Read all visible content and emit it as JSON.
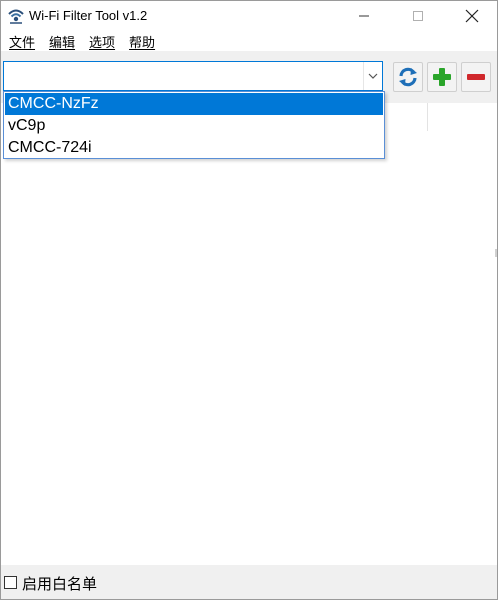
{
  "window": {
    "title": "Wi-Fi Filter Tool v1.2"
  },
  "menu": {
    "items": [
      "文件",
      "编辑",
      "选项",
      "帮助"
    ]
  },
  "toolbar": {
    "combo_value": "",
    "refresh_icon": "refresh-icon",
    "add_icon": "plus-icon",
    "remove_icon": "minus-icon"
  },
  "dropdown": {
    "options": [
      "CMCC-NzFz",
      "vC9p",
      "CMCC-724i"
    ],
    "selected_index": 0
  },
  "footer": {
    "whitelist_label": "启用白名单",
    "whitelist_checked": false
  },
  "colors": {
    "accent": "#0078d7",
    "refresh": "#1e6fb8",
    "add": "#2aa52a",
    "remove": "#d0282c"
  }
}
